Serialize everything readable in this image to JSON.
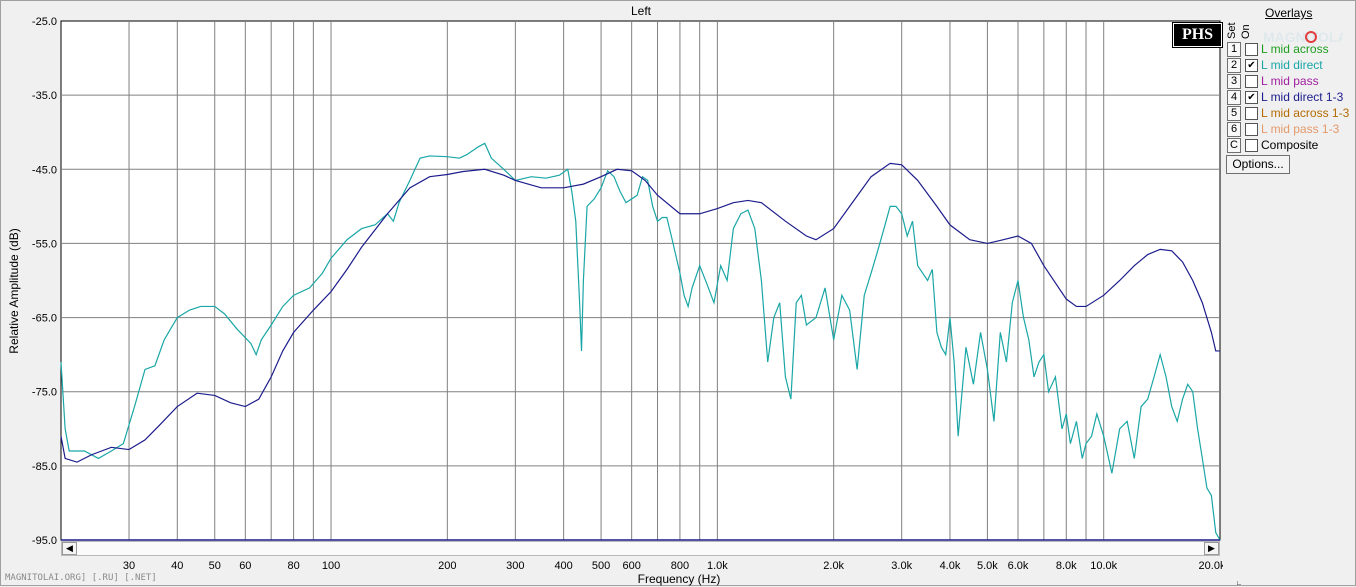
{
  "window": {
    "title": "Left"
  },
  "logo_text": "PHS",
  "watermark_text": "MAGNITOLAI.ORG] [.RU] [.NET]",
  "watermark_logo_text": "MAGNITOLA",
  "overlays": {
    "title": "Overlays",
    "set_label": "Set",
    "on_label": "On",
    "items": [
      {
        "num": "1",
        "label": "L mid across",
        "checked": false,
        "color": "#1e9e1e"
      },
      {
        "num": "2",
        "label": "L mid direct",
        "checked": true,
        "color": "#1aa6a6"
      },
      {
        "num": "3",
        "label": "L mid pass",
        "checked": false,
        "color": "#a020a0"
      },
      {
        "num": "4",
        "label": "L mid direct 1-3",
        "checked": true,
        "color": "#1c1c8c"
      },
      {
        "num": "5",
        "label": "L mid across 1-3",
        "checked": false,
        "color": "#b36b00"
      },
      {
        "num": "6",
        "label": "L mid pass 1-3",
        "checked": false,
        "color": "#e59a6a"
      },
      {
        "num": "C",
        "label": "Composite",
        "checked": false,
        "color": "#000000"
      }
    ],
    "options_label": "Options..."
  },
  "chart_data": {
    "type": "line",
    "title": "Left",
    "xlabel": "Frequency (Hz)",
    "ylabel": "Relative Amplitude (dB)",
    "xscale": "log",
    "xlim": [
      20,
      20000
    ],
    "ylim": [
      -95,
      -25
    ],
    "grid": true,
    "legend": "right",
    "y_ticks": [
      "-25.0",
      "-35.0",
      "-45.0",
      "-55.0",
      "-65.0",
      "-75.0",
      "-85.0",
      "-95.0"
    ],
    "x_ticks": [
      {
        "v": 30,
        "label": "30"
      },
      {
        "v": 40,
        "label": "40"
      },
      {
        "v": 50,
        "label": "50"
      },
      {
        "v": 60,
        "label": "60"
      },
      {
        "v": 80,
        "label": "80"
      },
      {
        "v": 100,
        "label": "100"
      },
      {
        "v": 200,
        "label": "200"
      },
      {
        "v": 300,
        "label": "300"
      },
      {
        "v": 400,
        "label": "400"
      },
      {
        "v": 500,
        "label": "500"
      },
      {
        "v": 600,
        "label": "600"
      },
      {
        "v": 800,
        "label": "800"
      },
      {
        "v": 1000,
        "label": "1.0k"
      },
      {
        "v": 2000,
        "label": "2.0k"
      },
      {
        "v": 3000,
        "label": "3.0k"
      },
      {
        "v": 4000,
        "label": "4.0k"
      },
      {
        "v": 5000,
        "label": "5.0k"
      },
      {
        "v": 6000,
        "label": "6.0k"
      },
      {
        "v": 8000,
        "label": "8.0k"
      },
      {
        "v": 10000,
        "label": "10.0k"
      },
      {
        "v": 20000,
        "label": "20.0k"
      }
    ],
    "series": [
      {
        "name": "L mid direct",
        "color": "#1aa6a6",
        "points": [
          [
            20,
            -71
          ],
          [
            20.5,
            -80
          ],
          [
            21,
            -83
          ],
          [
            23,
            -83
          ],
          [
            25,
            -84
          ],
          [
            27,
            -83
          ],
          [
            29,
            -82
          ],
          [
            31,
            -77
          ],
          [
            33,
            -72
          ],
          [
            35,
            -71.5
          ],
          [
            37,
            -68
          ],
          [
            40,
            -65
          ],
          [
            43,
            -64
          ],
          [
            46,
            -63.5
          ],
          [
            50,
            -63.5
          ],
          [
            53,
            -64.5
          ],
          [
            57,
            -66.5
          ],
          [
            62,
            -68.5
          ],
          [
            64,
            -70
          ],
          [
            66,
            -68
          ],
          [
            70,
            -66
          ],
          [
            75,
            -63.5
          ],
          [
            80,
            -62
          ],
          [
            88,
            -61
          ],
          [
            95,
            -59
          ],
          [
            100,
            -57
          ],
          [
            110,
            -54.5
          ],
          [
            120,
            -53
          ],
          [
            130,
            -52.5
          ],
          [
            140,
            -51
          ],
          [
            145,
            -52
          ],
          [
            150,
            -49.5
          ],
          [
            160,
            -46.5
          ],
          [
            170,
            -43.5
          ],
          [
            180,
            -43.2
          ],
          [
            200,
            -43.3
          ],
          [
            215,
            -43.5
          ],
          [
            225,
            -43
          ],
          [
            240,
            -42
          ],
          [
            250,
            -41.5
          ],
          [
            260,
            -43.5
          ],
          [
            280,
            -45
          ],
          [
            300,
            -46.5
          ],
          [
            330,
            -46
          ],
          [
            360,
            -46.2
          ],
          [
            390,
            -45.8
          ],
          [
            410,
            -45
          ],
          [
            420,
            -48
          ],
          [
            430,
            -52
          ],
          [
            440,
            -63
          ],
          [
            445,
            -69.5
          ],
          [
            450,
            -60
          ],
          [
            460,
            -50
          ],
          [
            480,
            -49
          ],
          [
            500,
            -47.5
          ],
          [
            520,
            -45.2
          ],
          [
            540,
            -46
          ],
          [
            560,
            -48
          ],
          [
            580,
            -49.5
          ],
          [
            600,
            -49
          ],
          [
            620,
            -48.5
          ],
          [
            640,
            -46
          ],
          [
            660,
            -46.5
          ],
          [
            680,
            -50
          ],
          [
            700,
            -52
          ],
          [
            720,
            -51.5
          ],
          [
            740,
            -51.5
          ],
          [
            760,
            -54
          ],
          [
            800,
            -59
          ],
          [
            820,
            -62
          ],
          [
            840,
            -63.5
          ],
          [
            860,
            -61
          ],
          [
            900,
            -58
          ],
          [
            940,
            -60.5
          ],
          [
            980,
            -63
          ],
          [
            1020,
            -58
          ],
          [
            1060,
            -60
          ],
          [
            1100,
            -53
          ],
          [
            1150,
            -51
          ],
          [
            1200,
            -50.5
          ],
          [
            1250,
            -53
          ],
          [
            1300,
            -60
          ],
          [
            1350,
            -71
          ],
          [
            1400,
            -65
          ],
          [
            1450,
            -63
          ],
          [
            1500,
            -73
          ],
          [
            1550,
            -76
          ],
          [
            1600,
            -63
          ],
          [
            1650,
            -62
          ],
          [
            1700,
            -66
          ],
          [
            1800,
            -65
          ],
          [
            1900,
            -61
          ],
          [
            2000,
            -68
          ],
          [
            2100,
            -62
          ],
          [
            2200,
            -64
          ],
          [
            2300,
            -72
          ],
          [
            2400,
            -62
          ],
          [
            2500,
            -59
          ],
          [
            2600,
            -56
          ],
          [
            2700,
            -53
          ],
          [
            2800,
            -50
          ],
          [
            2900,
            -50
          ],
          [
            3000,
            -51
          ],
          [
            3100,
            -54
          ],
          [
            3200,
            -52
          ],
          [
            3300,
            -58
          ],
          [
            3500,
            -60
          ],
          [
            3600,
            -58.5
          ],
          [
            3700,
            -67
          ],
          [
            3800,
            -69
          ],
          [
            3900,
            -70
          ],
          [
            4000,
            -65
          ],
          [
            4100,
            -71
          ],
          [
            4200,
            -81
          ],
          [
            4400,
            -69
          ],
          [
            4600,
            -74
          ],
          [
            4800,
            -67
          ],
          [
            5000,
            -72
          ],
          [
            5200,
            -79
          ],
          [
            5400,
            -67
          ],
          [
            5600,
            -71
          ],
          [
            5800,
            -63
          ],
          [
            6000,
            -60
          ],
          [
            6200,
            -65
          ],
          [
            6400,
            -68
          ],
          [
            6600,
            -73
          ],
          [
            6800,
            -71
          ],
          [
            7000,
            -70
          ],
          [
            7200,
            -75
          ],
          [
            7500,
            -73
          ],
          [
            7800,
            -80
          ],
          [
            8000,
            -78
          ],
          [
            8200,
            -82
          ],
          [
            8500,
            -79
          ],
          [
            8800,
            -84
          ],
          [
            9000,
            -82
          ],
          [
            9300,
            -81
          ],
          [
            9600,
            -78
          ],
          [
            10000,
            -81
          ],
          [
            10500,
            -86
          ],
          [
            11000,
            -80
          ],
          [
            11500,
            -79
          ],
          [
            12000,
            -84
          ],
          [
            12500,
            -77
          ],
          [
            13000,
            -76
          ],
          [
            13500,
            -73
          ],
          [
            14000,
            -70
          ],
          [
            14500,
            -73
          ],
          [
            15000,
            -77
          ],
          [
            15500,
            -79
          ],
          [
            16000,
            -76
          ],
          [
            16500,
            -74
          ],
          [
            17000,
            -75
          ],
          [
            17500,
            -80
          ],
          [
            18000,
            -84
          ],
          [
            18500,
            -88
          ],
          [
            19000,
            -89
          ],
          [
            19500,
            -94
          ],
          [
            20000,
            -95
          ]
        ]
      },
      {
        "name": "L mid direct 1-3",
        "color": "#1c1c8c",
        "points": [
          [
            20,
            -81
          ],
          [
            20.5,
            -84
          ],
          [
            22,
            -84.5
          ],
          [
            24,
            -83.5
          ],
          [
            27,
            -82.5
          ],
          [
            30,
            -82.8
          ],
          [
            33,
            -81.5
          ],
          [
            36,
            -79.5
          ],
          [
            40,
            -77
          ],
          [
            45,
            -75.2
          ],
          [
            50,
            -75.5
          ],
          [
            55,
            -76.5
          ],
          [
            60,
            -77
          ],
          [
            65,
            -76
          ],
          [
            70,
            -73
          ],
          [
            75,
            -69.5
          ],
          [
            80,
            -67
          ],
          [
            90,
            -64
          ],
          [
            100,
            -61.5
          ],
          [
            110,
            -58.5
          ],
          [
            120,
            -55.5
          ],
          [
            140,
            -51
          ],
          [
            160,
            -47.5
          ],
          [
            180,
            -46
          ],
          [
            200,
            -45.7
          ],
          [
            220,
            -45.3
          ],
          [
            250,
            -45
          ],
          [
            280,
            -45.8
          ],
          [
            300,
            -46.5
          ],
          [
            350,
            -47.5
          ],
          [
            400,
            -47.5
          ],
          [
            450,
            -47
          ],
          [
            500,
            -46
          ],
          [
            550,
            -45
          ],
          [
            600,
            -45.2
          ],
          [
            650,
            -46.5
          ],
          [
            700,
            -48.5
          ],
          [
            800,
            -51
          ],
          [
            900,
            -51
          ],
          [
            1000,
            -50.3
          ],
          [
            1100,
            -49.5
          ],
          [
            1200,
            -49.2
          ],
          [
            1300,
            -49.5
          ],
          [
            1500,
            -52
          ],
          [
            1700,
            -54
          ],
          [
            1800,
            -54.5
          ],
          [
            2000,
            -53
          ],
          [
            2200,
            -50
          ],
          [
            2500,
            -46
          ],
          [
            2800,
            -44.2
          ],
          [
            3000,
            -44.4
          ],
          [
            3300,
            -46.5
          ],
          [
            3700,
            -50
          ],
          [
            4000,
            -52.5
          ],
          [
            4500,
            -54.5
          ],
          [
            5000,
            -55
          ],
          [
            5500,
            -54.5
          ],
          [
            6000,
            -54
          ],
          [
            6500,
            -55
          ],
          [
            7000,
            -58
          ],
          [
            8000,
            -62.5
          ],
          [
            8500,
            -63.5
          ],
          [
            9000,
            -63.5
          ],
          [
            10000,
            -62
          ],
          [
            11000,
            -60
          ],
          [
            12000,
            -58
          ],
          [
            13000,
            -56.5
          ],
          [
            14000,
            -55.8
          ],
          [
            15000,
            -56
          ],
          [
            16000,
            -57.5
          ],
          [
            17000,
            -60
          ],
          [
            18000,
            -63
          ],
          [
            19000,
            -67
          ],
          [
            19500,
            -69.5
          ],
          [
            20000,
            -69.5
          ]
        ]
      }
    ]
  }
}
